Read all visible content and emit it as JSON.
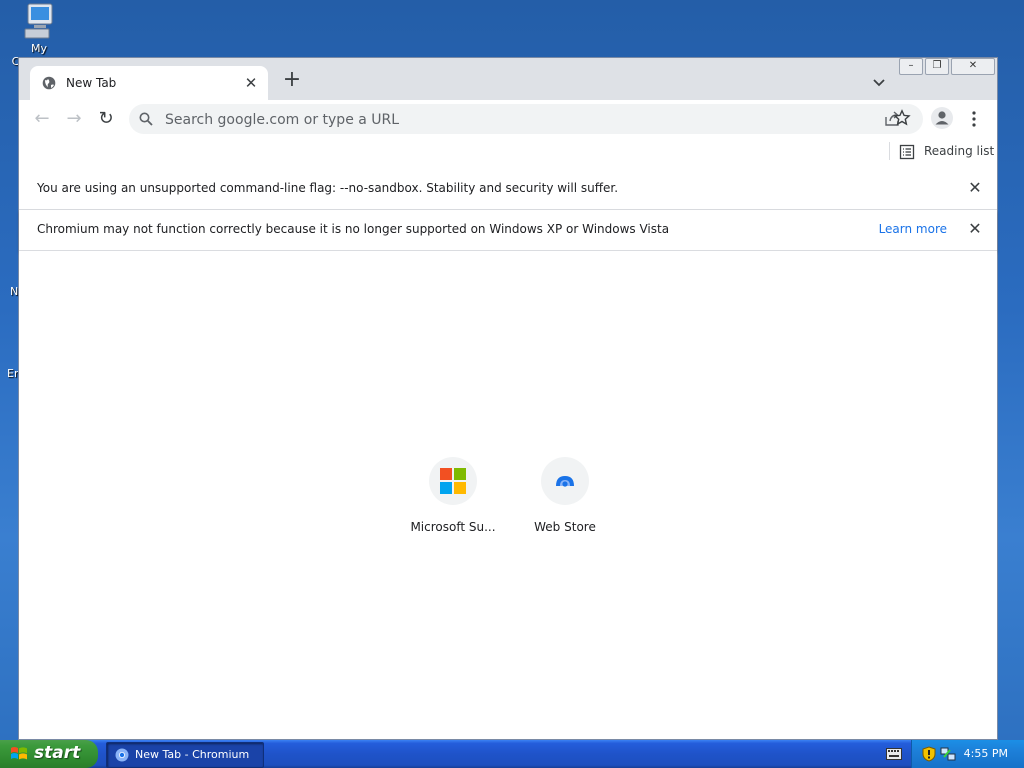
{
  "desktop": {
    "icons": [
      {
        "label": "My Computer",
        "icon": "computer-icon"
      }
    ],
    "edge_glimpses": [
      "N",
      "Er"
    ]
  },
  "browser": {
    "window_controls": {
      "minimize": "–",
      "restore": "❐",
      "close": "✕"
    },
    "tabs": [
      {
        "title": "New Tab",
        "icon": "globe-icon"
      }
    ],
    "new_tab_symbol": "+",
    "omnibox": {
      "placeholder": "Search google.com or type a URL",
      "value": ""
    },
    "bookmarks_bar": {
      "reading_list_label": "Reading list"
    },
    "infobars": [
      {
        "message": "You are using an unsupported command-line flag: --no-sandbox. Stability and security will suffer.",
        "link": ""
      },
      {
        "message": "Chromium may not function correctly because it is no longer supported on Windows XP or Windows Vista",
        "link": "Learn more"
      }
    ],
    "shortcuts": [
      {
        "label": "Microsoft Su...",
        "icon": "microsoft-logo-icon"
      },
      {
        "label": "Web Store",
        "icon": "web-store-icon"
      }
    ]
  },
  "taskbar": {
    "start_label": "start",
    "items": [
      {
        "label": "New Tab - Chromium",
        "icon": "chromium-icon",
        "active": true
      }
    ],
    "clock": "4:55 PM"
  },
  "colors": {
    "accent": "#1a73e8",
    "titlebar": "#dee1e6",
    "taskbar": "#1f53c9",
    "start_button": "#3c9a3c",
    "tray": "#1d7fd8"
  }
}
